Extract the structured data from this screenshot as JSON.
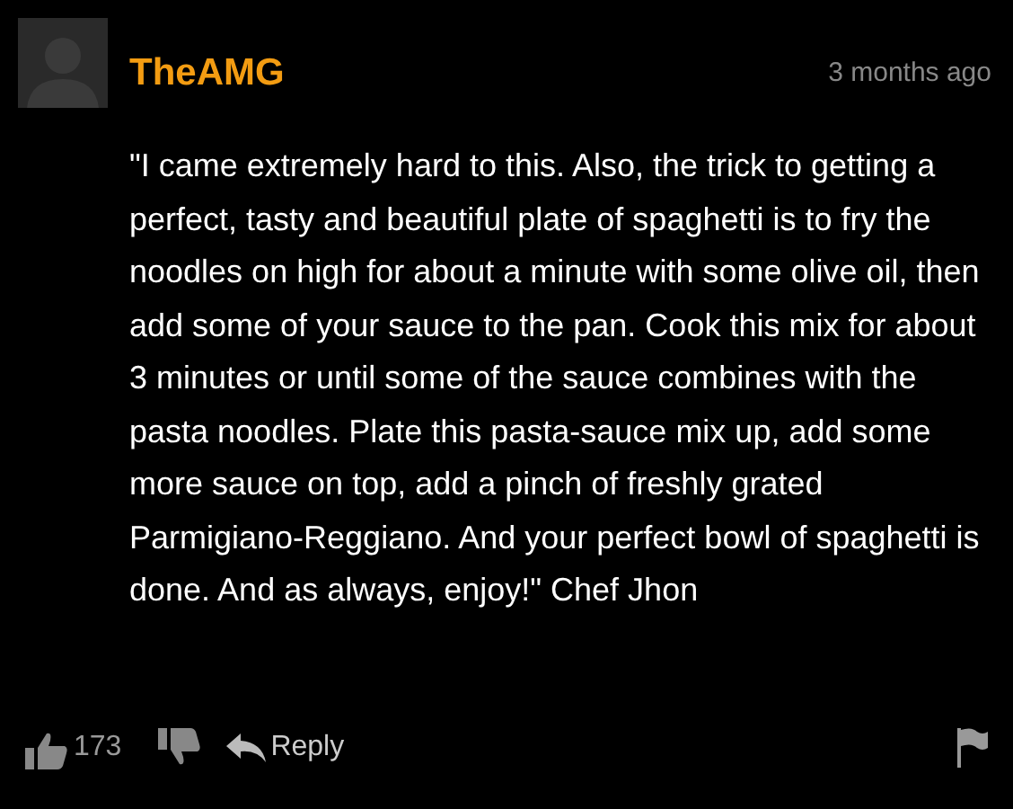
{
  "comment": {
    "username": "TheAMG",
    "time": "3 months ago",
    "body": "\"I came extremely hard to this. Also, the trick to getting a perfect, tasty and beautiful plate of spaghetti is to fry the noodles on high for about a minute with some olive oil, then add some of your sauce to the pan. Cook this mix for about 3 minutes or until some of the sauce combines with the pasta noodles. Plate this pasta-sauce mix up, add some more sauce on top, add a pinch of freshly grated Parmigiano-Reggiano. And your perfect bowl of spaghetti is done. And as always, enjoy!\" Chef Jhon",
    "likes": "173",
    "reply": "Reply"
  }
}
